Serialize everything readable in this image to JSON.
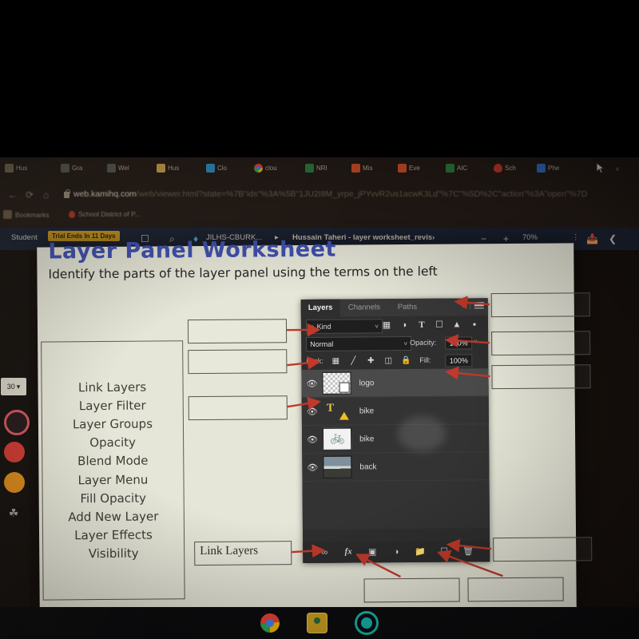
{
  "browser": {
    "tabs": [
      {
        "label": "Hus",
        "favicon": "folder-icon"
      },
      {
        "label": "Gra",
        "favicon": "person-icon"
      },
      {
        "label": "Wel",
        "favicon": "person-icon"
      },
      {
        "label": "Hus",
        "favicon": "folder-icon"
      },
      {
        "label": "Clo",
        "favicon": "person-icon"
      },
      {
        "label": "clou",
        "favicon": "chrome-icon"
      },
      {
        "label": "NRI",
        "favicon": "person-icon"
      },
      {
        "label": "Mis",
        "favicon": "person-icon"
      },
      {
        "label": "Eve",
        "favicon": "person-icon"
      },
      {
        "label": "AIC",
        "favicon": "person-icon"
      },
      {
        "label": "Sch",
        "favicon": "drop-icon"
      },
      {
        "label": "Phe",
        "favicon": "person-icon"
      }
    ],
    "nav": {
      "back": "←",
      "reload": "⟳",
      "home": "⌂"
    },
    "url_domain": "web.kamihq.com",
    "url_path": "/web/viewer.html?state=%7B\"ids\"%3A%5B\"1JU2I8M_yrpe_jPYvvR2us1acwK3Ld\"%7C\"%5D%2C\"action\"%3A\"open\"%7D",
    "close_label": "×",
    "bookmarks": [
      {
        "label": "Bookmarks",
        "icon": "folder-icon"
      },
      {
        "label": "School District of P...",
        "icon": "drop-icon"
      }
    ]
  },
  "kami": {
    "student_label": "Student",
    "trial_badge": "Trial Ends In 11 Days",
    "thumbnails_icon": "panel-icon",
    "search_icon": "search-icon",
    "app_icon": "kami-icon",
    "breadcrumb_class": "JILHS-CBURK...",
    "breadcrumb_sep": "▸",
    "doc_title": "Hussain Taheri - layer worksheet_revis›",
    "zoom_out": "−",
    "zoom_in": "+",
    "zoom_level": "70%",
    "more_icon": "⋮",
    "save_icon": "save-icon",
    "share_icon": "share-icon"
  },
  "rail": {
    "size_value": "30",
    "size_caret": "▾",
    "colors": [
      "#cf3a33",
      "#de8a1b"
    ],
    "brain_icon": "brain-icon"
  },
  "worksheet": {
    "title": "Layer Panel Worksheet",
    "subtitle": "Identify the parts of the layer panel using the terms on the left",
    "terms": [
      "Link Layers",
      "Layer Filter",
      "Layer Groups",
      "Opacity",
      "Blend Mode",
      "Layer Menu",
      "Fill Opacity",
      "Add New Layer",
      "Layer Effects",
      "Visibility"
    ],
    "answers": {
      "left_layer_filter": "",
      "left_blend_mode": "",
      "left_visibility": "",
      "left_link_layers": "Link Layers",
      "right_layer_menu": "",
      "right_opacity": "",
      "right_fill_opacity": "",
      "right_add_new_layer": "",
      "bottom_layer_effects": "",
      "bottom_layer_groups": ""
    }
  },
  "photoshop": {
    "tabs": [
      {
        "label": "Layers",
        "active": true
      },
      {
        "label": "Channels",
        "active": false
      },
      {
        "label": "Paths",
        "active": false
      }
    ],
    "panel_collapse": "»",
    "panel_menu_icon": "hamburger-menu-icon",
    "filter": {
      "kind_label": "Kind",
      "search_icon": "search-icon",
      "caret": "˅",
      "icons": [
        "image-filter-icon",
        "adjustment-filter-icon",
        "type-filter-icon",
        "shape-filter-icon",
        "smartobject-filter-icon",
        "toggle-filter-dot-icon"
      ]
    },
    "blend_mode": "Normal",
    "blend_caret": "˅",
    "opacity_label": "Opacity:",
    "opacity_value": "100%",
    "opacity_caret": "˅",
    "lock_label": "Lock:",
    "lock_icons": [
      "lock-transparency-icon",
      "lock-image-icon",
      "lock-position-icon",
      "lock-artboard-icon",
      "lock-all-icon"
    ],
    "fill_label": "Fill:",
    "fill_value": "100%",
    "layers": [
      {
        "name": "logo",
        "visible": true,
        "selected": true,
        "thumb": "checker-thumb",
        "badge": "smart-object-badge"
      },
      {
        "name": "bike",
        "visible": true,
        "selected": false,
        "thumb": "type-thumb",
        "badge": "warning-badge"
      },
      {
        "name": "bike",
        "visible": true,
        "selected": false,
        "thumb": "bike-photo-thumb",
        "badge": ""
      },
      {
        "name": "back",
        "visible": true,
        "selected": false,
        "thumb": "landscape-photo-thumb",
        "badge": ""
      }
    ],
    "eye_icon": "eye-icon",
    "bottom_icons": [
      "link-layers-icon",
      "layer-effects-fx-icon",
      "layer-mask-icon",
      "adjustment-layer-icon",
      "new-group-folder-icon",
      "new-layer-icon",
      "delete-layer-trash-icon"
    ],
    "fx_label": "fx"
  },
  "taskbar": {
    "items": [
      {
        "name": "chrome",
        "icon": "chrome-icon"
      },
      {
        "name": "classroom",
        "icon": "google-classroom-icon"
      },
      {
        "name": "settings",
        "icon": "gear-icon"
      }
    ]
  },
  "colors": {
    "arrow_red": "#c0392b",
    "title_blue": "#3f4fb0",
    "trial_badge": "#c8961f",
    "paper": "#e6e6d8"
  }
}
